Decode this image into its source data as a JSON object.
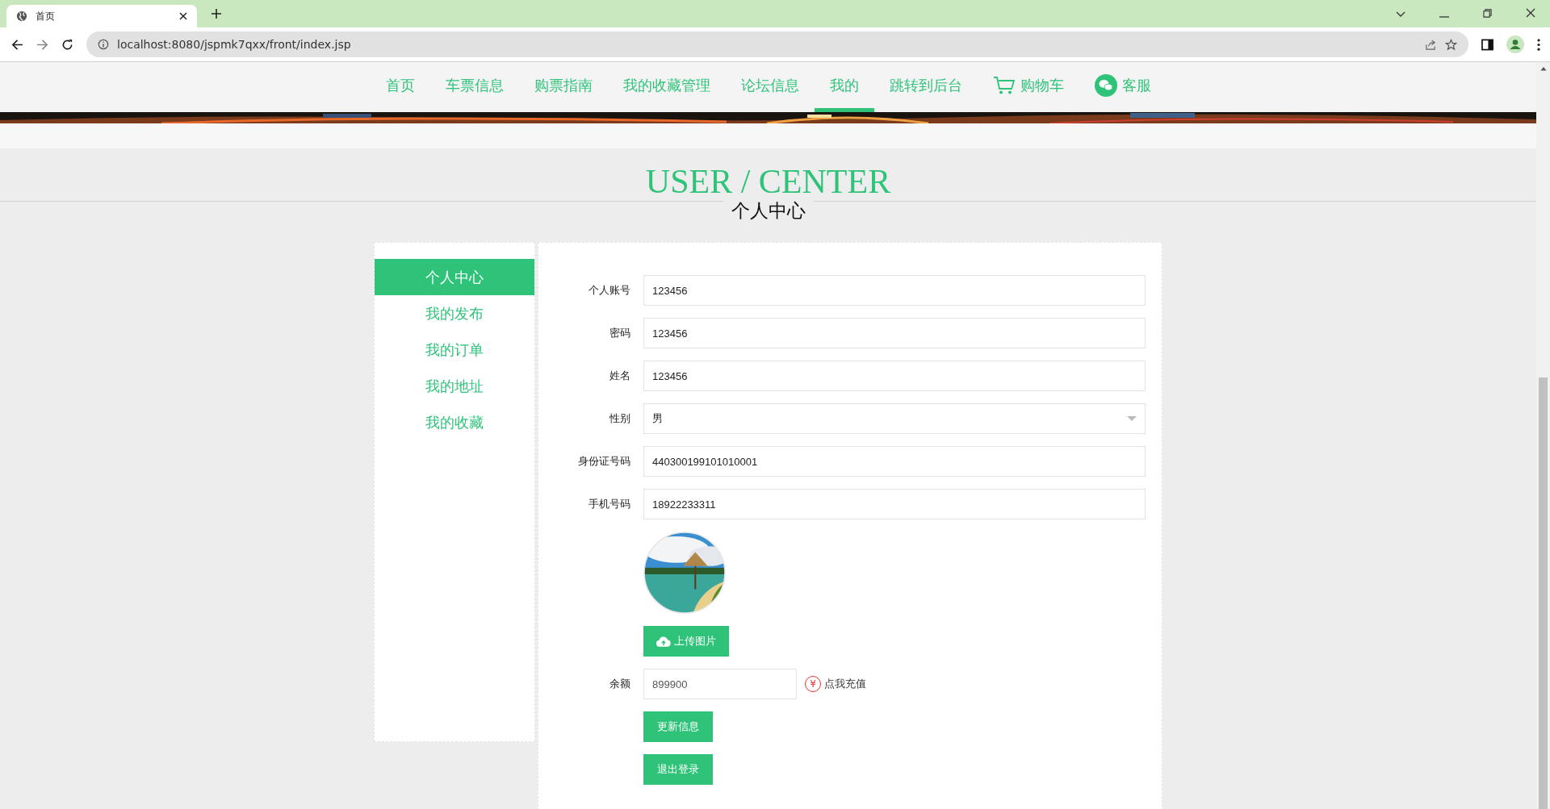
{
  "browser": {
    "tab_title": "首页",
    "url": "localhost:8080/jspmk7qxx/front/index.jsp"
  },
  "nav": [
    {
      "label": "首页",
      "selected": false,
      "kind": "text"
    },
    {
      "label": "车票信息",
      "selected": false,
      "kind": "text"
    },
    {
      "label": "购票指南",
      "selected": false,
      "kind": "text"
    },
    {
      "label": "我的收藏管理",
      "selected": false,
      "kind": "text"
    },
    {
      "label": "论坛信息",
      "selected": false,
      "kind": "text"
    },
    {
      "label": "我的",
      "selected": true,
      "kind": "text"
    },
    {
      "label": "跳转到后台",
      "selected": false,
      "kind": "text"
    },
    {
      "label": "购物车",
      "selected": false,
      "kind": "cart"
    },
    {
      "label": "客服",
      "selected": false,
      "kind": "chat"
    }
  ],
  "header": {
    "title": "USER / CENTER",
    "subtitle": "个人中心"
  },
  "sidebar": {
    "items": [
      {
        "label": "个人中心",
        "selected": true
      },
      {
        "label": "我的发布",
        "selected": false
      },
      {
        "label": "我的订单",
        "selected": false
      },
      {
        "label": "我的地址",
        "selected": false
      },
      {
        "label": "我的收藏",
        "selected": false
      }
    ]
  },
  "form": {
    "fields": [
      {
        "label": "个人账号",
        "value": "123456",
        "kind": "text"
      },
      {
        "label": "密码",
        "value": "123456",
        "kind": "text"
      },
      {
        "label": "姓名",
        "value": "123456",
        "kind": "text"
      },
      {
        "label": "性别",
        "value": "男",
        "kind": "select"
      },
      {
        "label": "身份证号码",
        "value": "440300199101010001",
        "kind": "text"
      },
      {
        "label": "手机号码",
        "value": "18922233311",
        "kind": "text"
      }
    ],
    "upload_button": "上传图片",
    "balance": {
      "label": "余额",
      "value": "899900",
      "recharge_icon": "¥",
      "recharge_link": "点我充值"
    },
    "buttons": [
      "更新信息",
      "退出登录"
    ]
  }
}
